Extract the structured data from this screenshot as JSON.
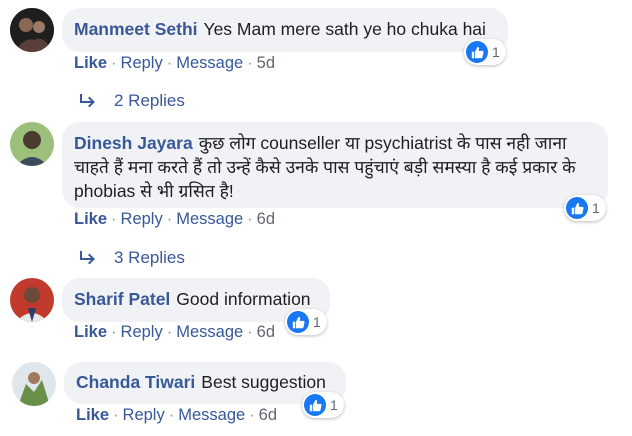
{
  "comments": [
    {
      "name": "Manmeet Sethi",
      "text": "Yes Mam mere sath ye ho chuka hai",
      "like_label": "Like",
      "reply_label": "Reply",
      "message_label": "Message",
      "time": "5d",
      "reactions": "1",
      "replies_label": "2 Replies"
    },
    {
      "name": "Dinesh Jayara",
      "text": "कुछ लोग counseller या psychiatrist के पास नही जाना",
      "text_line2": "चाहते हैं मना करते हैं तो उन्हें कैसे उनके पास पहुंचाएं बड़ी समस्या है कई प्रकार के",
      "text_line3": "phobias से भी ग्रसित है!",
      "like_label": "Like",
      "reply_label": "Reply",
      "message_label": "Message",
      "time": "6d",
      "reactions": "1",
      "replies_label": "3 Replies"
    },
    {
      "name": "Sharif Patel",
      "text": "Good information",
      "like_label": "Like",
      "reply_label": "Reply",
      "message_label": "Message",
      "time": "6d",
      "reactions": "1"
    },
    {
      "name": "Chanda Tiwari",
      "text": "Best suggestion",
      "like_label": "Like",
      "reply_label": "Reply",
      "message_label": "Message",
      "time": "6d",
      "reactions": "1"
    }
  ],
  "colors": {
    "link": "#385898",
    "bubble": "#f0f2f5",
    "like_blue": "#1877f2",
    "meta": "#606770"
  },
  "separator": "·"
}
